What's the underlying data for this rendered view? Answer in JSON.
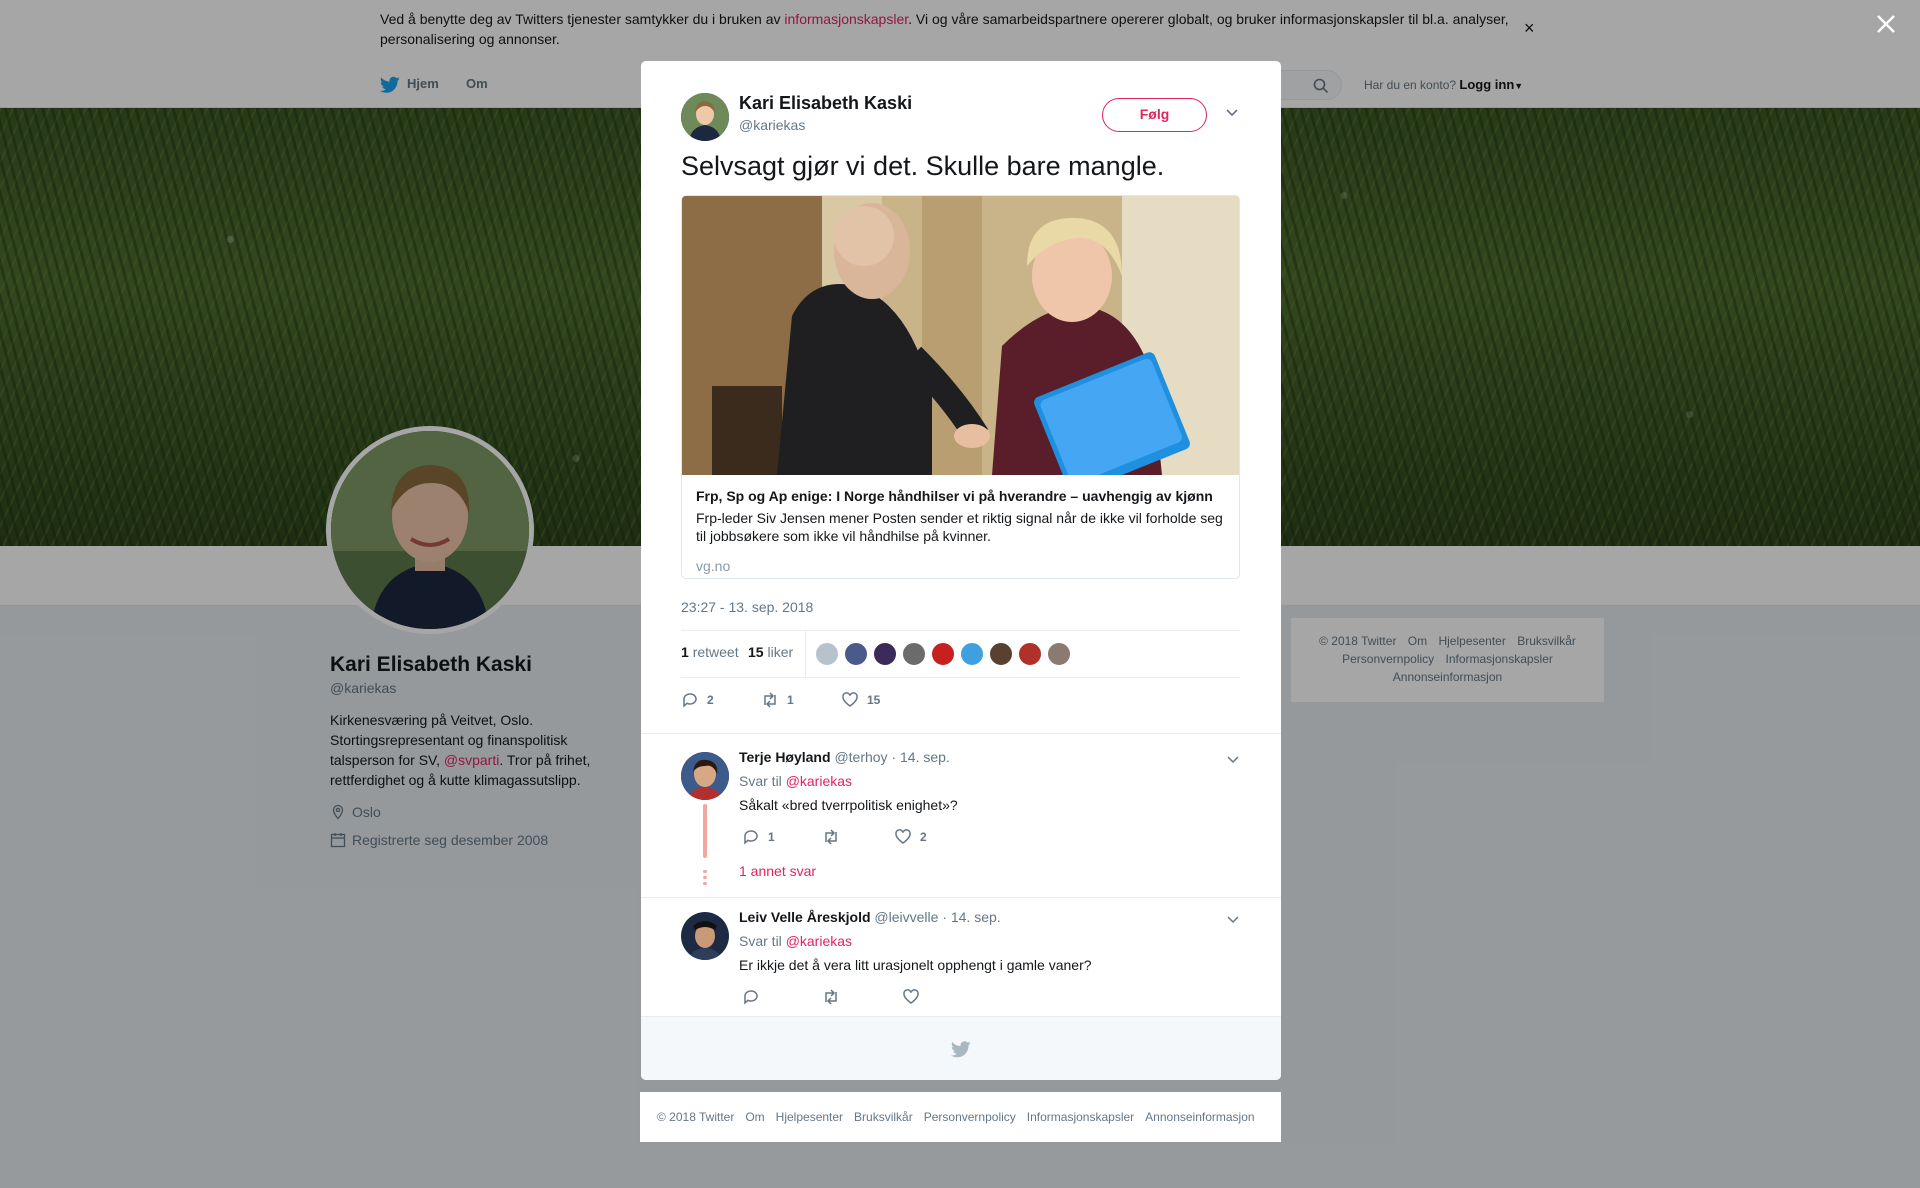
{
  "cookie_bar": {
    "text_before": "Ved å benytte deg av Twitters tjenester samtykker du i bruken av ",
    "link": "informasjonskapsler",
    "text_after": ". Vi og våre samarbeidspartnere opererer globalt, og bruker informasjonskapsler til bl.a. analyser, personalisering og annonser.",
    "close": "×"
  },
  "topnav": {
    "home": "Hjem",
    "about": "Om",
    "account_prompt": "Har du en konto?",
    "login": "Logg inn"
  },
  "profile": {
    "name": "Kari Elisabeth Kaski",
    "handle": "@kariekas",
    "bio_before": "Kirkenesværing på Veitvet, Oslo. Stortingsrepresentant og finanspolitisk talsperson for SV, ",
    "bio_link": "@svparti",
    "bio_after": ". Tror på frihet, rettferdighet og å kutte klimagassutslipp.",
    "location": "Oslo",
    "joined": "Registrerte seg desember 2008"
  },
  "side_footer": {
    "links": [
      "© 2018 Twitter",
      "Om",
      "Hjelpesenter",
      "Bruksvilkår",
      "Personvernpolicy",
      "Informasjonskapsler",
      "Annonseinformasjon"
    ]
  },
  "tweet": {
    "author_name": "Kari Elisabeth Kaski",
    "author_handle": "@kariekas",
    "follow_label": "Følg",
    "text": "Selvsagt gjør vi det. Skulle bare mangle.",
    "card": {
      "title": "Frp, Sp og Ap enige: I Norge håndhilser vi på hverandre – uavhengig av kjønn",
      "description": "Frp-leder Siv Jensen mener Posten sender et riktig signal når de ikke vil forholde seg til jobbsøkere som ikke vil håndhilse på kvinner.",
      "domain": "vg.no"
    },
    "timestamp": "23:27 - 13. sep. 2018",
    "retweets_count": "1",
    "retweets_label": "retweet",
    "likes_count": "15",
    "likes_label": "liker",
    "reply_count": "2",
    "retweet_count": "1",
    "like_count": "15"
  },
  "replies": [
    {
      "name": "Terje Høyland",
      "handle": "@terhoy",
      "date": "· 14. sep.",
      "reply_to_label": "Svar til",
      "reply_to": "@kariekas",
      "text": "Såkalt «bred tverrpolitisk enighet»?",
      "reply_count": "1",
      "retweet_count": "",
      "like_count": "2",
      "more": "1 annet svar"
    },
    {
      "name": "Leiv Velle Åreskjold",
      "handle": "@leivvelle",
      "date": "· 14. sep.",
      "reply_to_label": "Svar til",
      "reply_to": "@kariekas",
      "text": "Er ikkje det å vera litt urasjonelt opphengt i gamle vaner?",
      "reply_count": "",
      "retweet_count": "",
      "like_count": ""
    }
  ],
  "bottom_footer": {
    "links": [
      "© 2018 Twitter",
      "Om",
      "Hjelpesenter",
      "Bruksvilkår",
      "Personvernpolicy",
      "Informasjonskapsler",
      "Annonseinformasjon"
    ]
  },
  "icons": {
    "bird": "twitter-bird-icon",
    "search": "search-icon",
    "close": "close-icon",
    "caret": "chevron-down-icon",
    "reply": "reply-icon",
    "retweet": "retweet-icon",
    "like": "heart-icon",
    "location": "location-pin-icon",
    "calendar": "calendar-icon"
  },
  "colors": {
    "accent": "#e0245e",
    "twitter_blue": "#1da1f2",
    "muted": "#657786"
  }
}
